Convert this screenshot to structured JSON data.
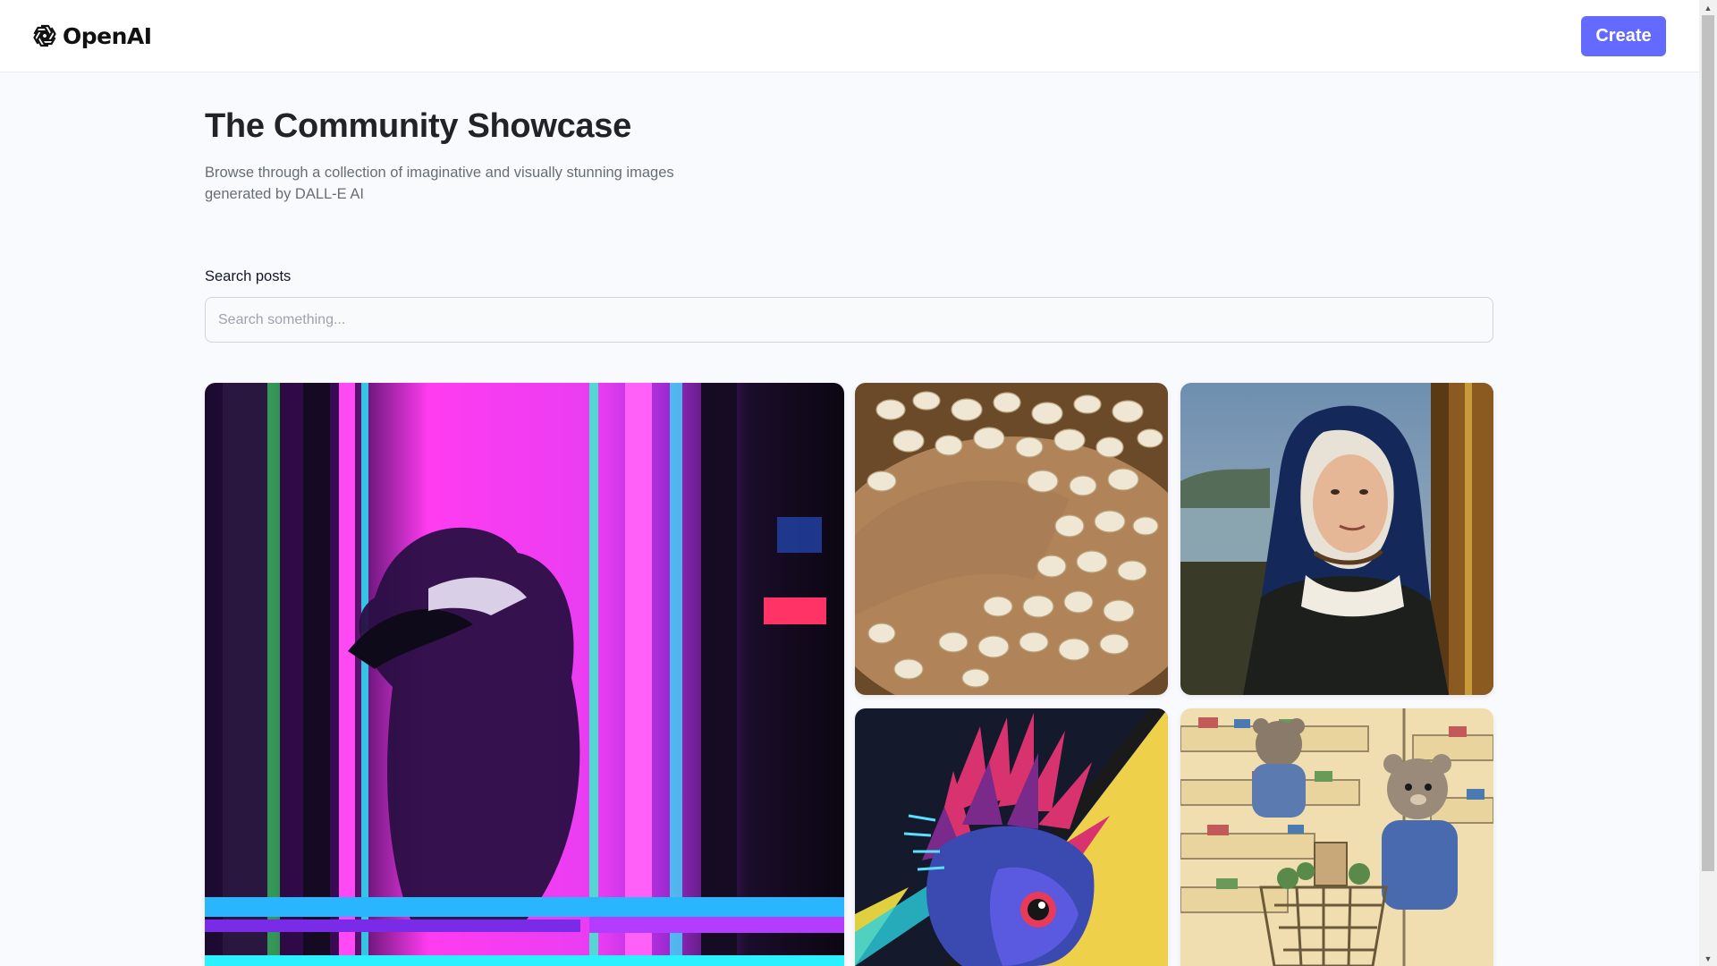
{
  "header": {
    "logo_text": "OpenAI",
    "create_label": "Create"
  },
  "intro": {
    "title": "The Community Showcase",
    "subtitle": "Browse through a collection of imaginative and visually stunning images generated by DALL-E AI"
  },
  "search": {
    "label": "Search posts",
    "placeholder": "Search something...",
    "value": ""
  },
  "gallery": {
    "items": [
      {
        "subject": "neon-glitch-raccoon"
      },
      {
        "subject": "oat-grains-bowl"
      },
      {
        "subject": "renaissance-portrait-woman-blue-hood"
      },
      {
        "subject": "pop-art-hedgehog"
      },
      {
        "subject": "teddy-bears-grocery-shopping"
      }
    ]
  },
  "colors": {
    "accent": "#6469ff",
    "page_background": "#f9fafe",
    "title": "#222328",
    "subtitle": "#666e75"
  },
  "icons": {
    "logo": "openai-logo-icon",
    "scroll_up": "scroll-up-arrow-icon",
    "scroll_down": "scroll-down-arrow-icon"
  }
}
